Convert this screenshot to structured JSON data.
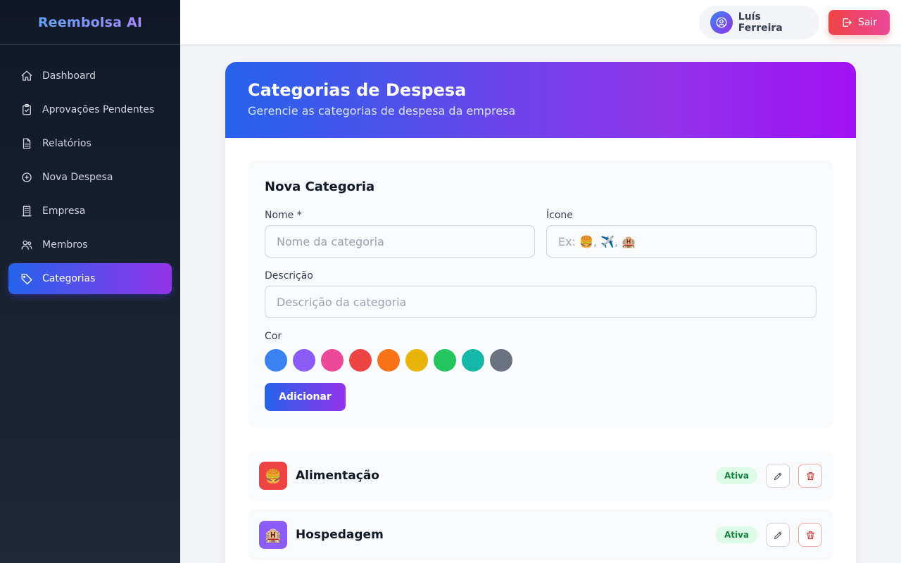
{
  "app": {
    "brand": "Reembolsa AI"
  },
  "sidebar": {
    "items": [
      {
        "label": "Dashboard",
        "icon": "home-icon"
      },
      {
        "label": "Aprovações Pendentes",
        "icon": "clipboard-check-icon"
      },
      {
        "label": "Relatórios",
        "icon": "document-icon"
      },
      {
        "label": "Nova Despesa",
        "icon": "plus-circle-icon"
      },
      {
        "label": "Empresa",
        "icon": "building-icon"
      },
      {
        "label": "Membros",
        "icon": "users-icon"
      },
      {
        "label": "Categorias",
        "icon": "tag-icon",
        "active": true
      }
    ]
  },
  "header": {
    "user_name": "Luís Ferreira",
    "logout_label": "Sair"
  },
  "page": {
    "title": "Categorias de Despesa",
    "subtitle": "Gerencie as categorias de despesa da empresa"
  },
  "form": {
    "title": "Nova Categoria",
    "name_label": "Nome *",
    "name_placeholder": "Nome da categoria",
    "icon_label": "Ícone",
    "icon_placeholder": "Ex: 🍔, ✈️, 🏨",
    "description_label": "Descrição",
    "description_placeholder": "Descrição da categoria",
    "color_label": "Cor",
    "colors": [
      "#3b82f6",
      "#8b5cf6",
      "#ec4899",
      "#ef4444",
      "#f97316",
      "#eab308",
      "#22c55e",
      "#14b8a6",
      "#6b7280"
    ],
    "submit_label": "Adicionar"
  },
  "categories": [
    {
      "name": "Alimentação",
      "emoji": "🍔",
      "color": "#ef4444",
      "status": "Ativa"
    },
    {
      "name": "Hospedagem",
      "emoji": "🏨",
      "color": "#8b5cf6",
      "status": "Ativa"
    }
  ]
}
